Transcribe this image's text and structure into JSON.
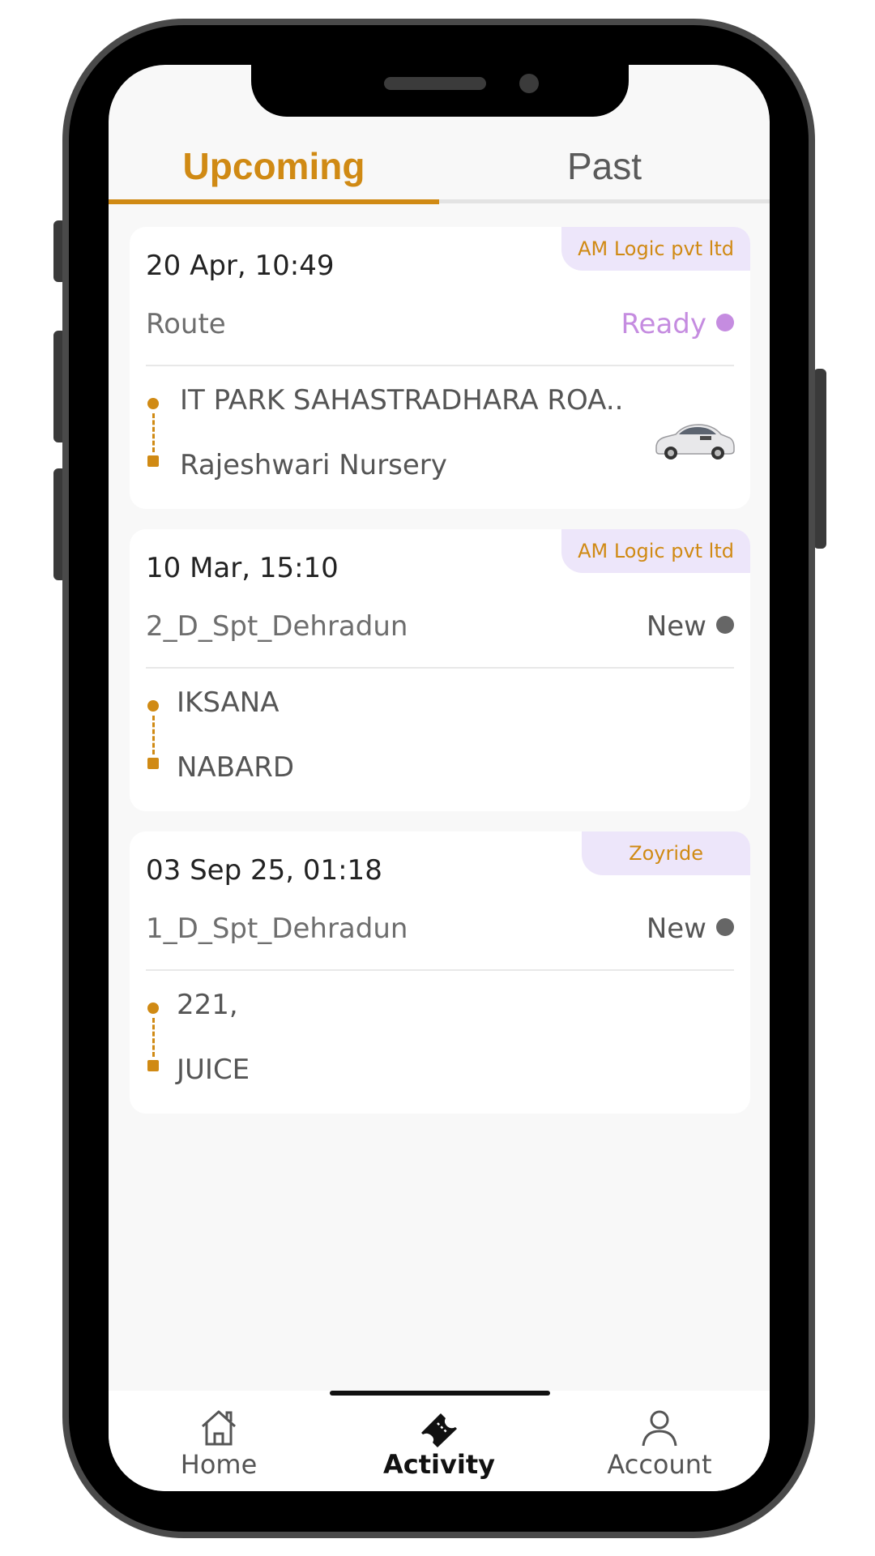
{
  "tabs": [
    {
      "label": "Upcoming",
      "active": true
    },
    {
      "label": "Past",
      "active": false
    }
  ],
  "rides": [
    {
      "company": "AM Logic pvt ltd",
      "datetime": "20 Apr, 10:49",
      "route": "Route",
      "status": "Ready",
      "status_color": "#c58ce0",
      "pickup": "IT PARK SAHASTRADHARA ROA..",
      "drop": "Rajeshwari Nursery",
      "vehicle_icon": "car-icon"
    },
    {
      "company": "AM Logic pvt ltd",
      "datetime": "10 Mar, 15:10",
      "route": "2_D_Spt_Dehradun",
      "status": "New",
      "status_color": "#666666",
      "pickup": "IKSANA",
      "drop": "NABARD"
    },
    {
      "company": "Zoyride",
      "datetime": "03 Sep 25, 01:18",
      "route": "1_D_Spt_Dehradun",
      "status": "New",
      "status_color": "#666666",
      "pickup": "221,",
      "drop": "JUICE"
    }
  ],
  "nav": [
    {
      "label": "Home",
      "icon": "home-icon",
      "active": false
    },
    {
      "label": "Activity",
      "icon": "ticket-icon",
      "active": true
    },
    {
      "label": "Account",
      "icon": "user-icon",
      "active": false
    }
  ],
  "colors": {
    "accent": "#D08A14",
    "badge_bg": "#ede6fa"
  }
}
